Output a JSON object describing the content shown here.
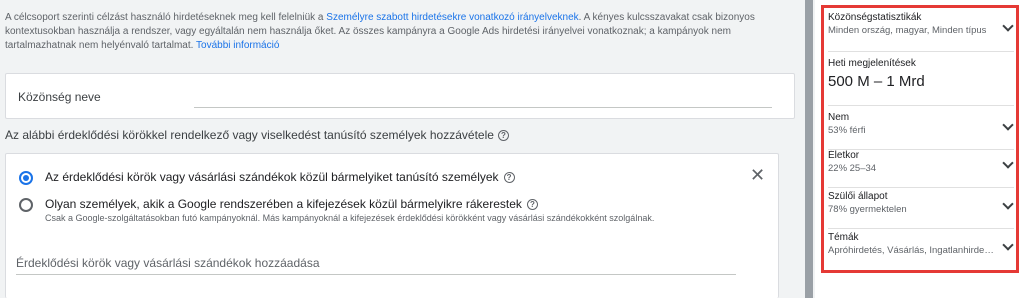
{
  "notice": {
    "text1": "A célcsoport szerinti célzást használó hirdetéseknek meg kell felelniük a ",
    "link1": "Személyre szabott hirdetésekre vonatkozó irányelveknek",
    "text2": ". A kényes kulcsszavakat csak bizonyos kontextusokban használja a rendszer, vagy egyáltalán nem használja őket. Az összes kampányra a Google Ads hirdetési irányelvei vonatkoznak; a kampányok nem tartalmazhatnak nem helyénvaló tartalmat. ",
    "link2": "További információ"
  },
  "audience_name": {
    "label": "Közönség neve",
    "value": ""
  },
  "section": {
    "title": "Az alábbi érdeklődési körökkel rendelkező vagy viselkedést tanúsító személyek hozzávétele"
  },
  "options": [
    {
      "label": "Az érdeklődési körök vagy vásárlási szándékok közül bármelyiket tanúsító személyek",
      "sub": "",
      "selected": true
    },
    {
      "label": "Olyan személyek, akik a Google rendszerében a kifejezések közül bármelyikre rákerestek",
      "sub": "Csak a Google-szolgáltatásokban futó kampányoknál. Más kampányoknál a kifejezések érdeklődési körökként vagy vásárlási szándékokként szolgálnak.",
      "selected": false
    }
  ],
  "search": {
    "placeholder": "Érdeklődési körök vagy vásárlási szándékok hozzáadása"
  },
  "sidebar": {
    "stats": {
      "title": "Közönségstatisztikák",
      "value": "Minden ország, magyar, Minden típus"
    },
    "weekly": {
      "title": "Heti megjelenítések",
      "value": "500 M – 1 Mrd"
    },
    "gender": {
      "title": "Nem",
      "value": "53% férfi"
    },
    "age": {
      "title": "Életkor",
      "value": "22% 25–34"
    },
    "parental": {
      "title": "Szülői állapot",
      "value": "78% gyermektelen"
    },
    "topics": {
      "title": "Témák",
      "value": "Apróhirdetés, Vásárlás, Ingatlanhirdetések"
    }
  },
  "colors": {
    "accent": "#1a73e8",
    "highlight": "#e53935"
  }
}
